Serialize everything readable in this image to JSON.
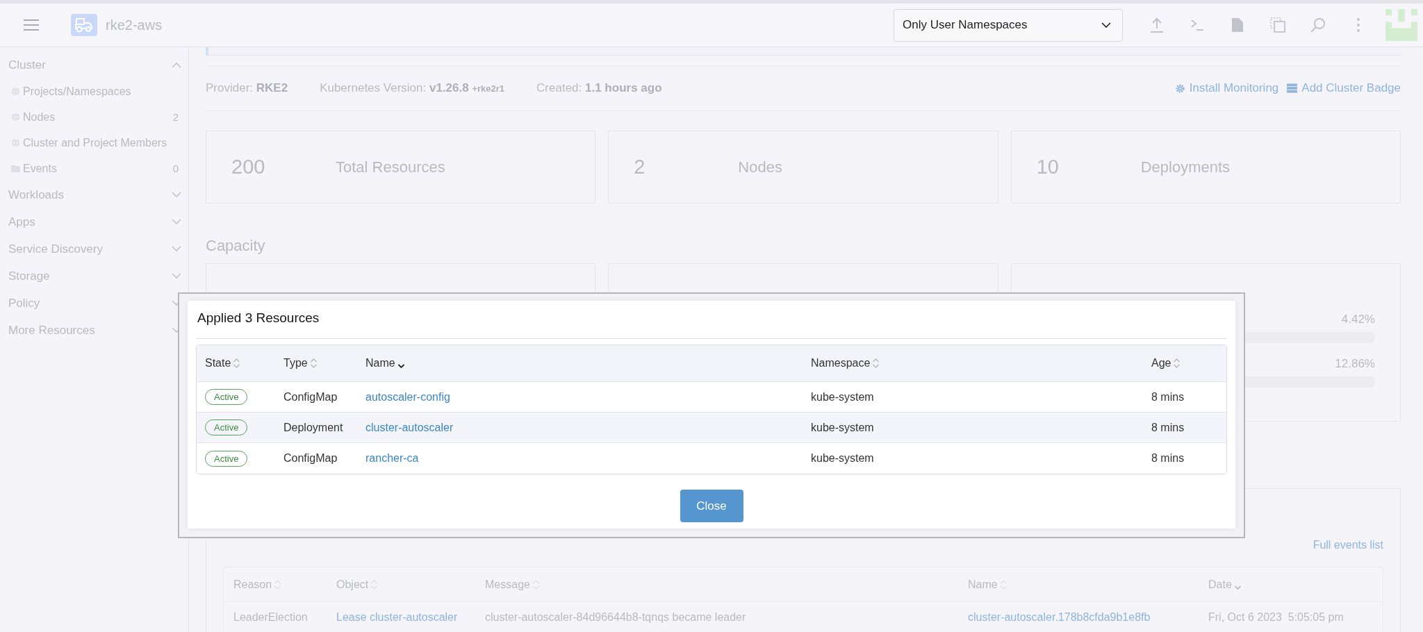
{
  "header": {
    "cluster_name": "rke2-aws",
    "namespace_filter": "Only User Namespaces"
  },
  "sidebar": {
    "groups": [
      {
        "label": "Cluster",
        "expanded": true,
        "children": [
          {
            "label": "Projects/Namespaces",
            "kind": "globe"
          },
          {
            "label": "Nodes",
            "kind": "globe",
            "count": "2"
          },
          {
            "label": "Cluster and Project Members",
            "kind": "globe"
          },
          {
            "label": "Events",
            "kind": "folder",
            "count": "0"
          }
        ]
      },
      {
        "label": "Workloads",
        "expanded": false
      },
      {
        "label": "Apps",
        "expanded": false
      },
      {
        "label": "Service Discovery",
        "expanded": false
      },
      {
        "label": "Storage",
        "expanded": false
      },
      {
        "label": "Policy",
        "expanded": false
      },
      {
        "label": "More Resources",
        "expanded": false
      }
    ]
  },
  "info": {
    "items": [
      {
        "label": "Provider:",
        "value": "RKE2"
      },
      {
        "label": "Kubernetes Version:",
        "value": "v1.26.8",
        "suffix": "+rke2r1"
      },
      {
        "label": "Created:",
        "value": "1.1 hours ago"
      }
    ],
    "actions": [
      {
        "label": "Install Monitoring",
        "kind": "gear"
      },
      {
        "label": "Add Cluster Badge",
        "kind": "badge"
      }
    ]
  },
  "stats": [
    {
      "count": "200",
      "label": "Total Resources"
    },
    {
      "count": "2",
      "label": "Nodes"
    },
    {
      "count": "10",
      "label": "Deployments"
    }
  ],
  "capacity": {
    "title": "Capacity",
    "readings": [
      "4.42%",
      "12.86%"
    ]
  },
  "events": {
    "link": "Full events list",
    "columns": [
      {
        "label": "Reason",
        "sorted": false
      },
      {
        "label": "Object",
        "sorted": false
      },
      {
        "label": "Message",
        "sorted": false
      },
      {
        "label": "Name",
        "sorted": false
      },
      {
        "label": "Date",
        "sorted": true
      }
    ],
    "rows": [
      {
        "reason": "LeaderElection",
        "object": "Lease cluster-autoscaler",
        "message": "cluster-autoscaler-84d96644b8-tqnqs became leader",
        "name": "cluster-autoscaler.178b8cfda9b1e8fb",
        "date": "Fri, Oct 6 2023  5:05:05 pm"
      }
    ]
  },
  "dialog": {
    "title": "Applied 3 Resources",
    "columns": [
      {
        "label": "State",
        "sorted": false
      },
      {
        "label": "Type",
        "sorted": false
      },
      {
        "label": "Name",
        "sorted": true
      },
      {
        "label": "Namespace",
        "sorted": false
      },
      {
        "label": "Age",
        "sorted": false
      }
    ],
    "rows": [
      {
        "state": "Active",
        "type": "ConfigMap",
        "name": "autoscaler-config",
        "namespace": "kube-system",
        "age": "8 mins"
      },
      {
        "state": "Active",
        "type": "Deployment",
        "name": "cluster-autoscaler",
        "namespace": "kube-system",
        "age": "8 mins"
      },
      {
        "state": "Active",
        "type": "ConfigMap",
        "name": "rancher-ca",
        "namespace": "kube-system",
        "age": "8 mins"
      }
    ],
    "button": "Close"
  }
}
